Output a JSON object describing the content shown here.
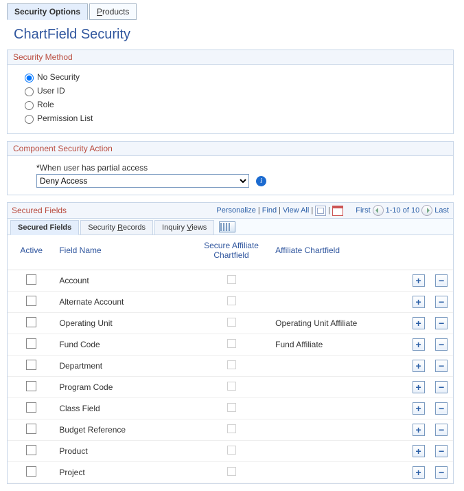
{
  "tabs": {
    "active": "Security Options",
    "other": "Products"
  },
  "page_title": "ChartField Security",
  "security_method": {
    "header": "Security Method",
    "options": [
      "No Security",
      "User ID",
      "Role",
      "Permission List"
    ],
    "selected": "No Security"
  },
  "component_action": {
    "header": "Component Security Action",
    "label": "When user has partial access",
    "select_value": "Deny Access"
  },
  "secured_fields": {
    "header": "Secured Fields",
    "links": {
      "personalize": "Personalize",
      "find": "Find",
      "viewall": "View All",
      "first": "First",
      "last": "Last"
    },
    "range": "1-10 of 10",
    "subtabs": [
      "Secured Fields",
      "Security Records",
      "Inquiry Views"
    ],
    "columns": {
      "active": "Active",
      "field_name": "Field Name",
      "secure_affiliate": "Secure Affiliate Chartfield",
      "affiliate": "Affiliate Chartfield"
    },
    "rows": [
      {
        "name": "Account",
        "aff": ""
      },
      {
        "name": "Alternate Account",
        "aff": ""
      },
      {
        "name": "Operating Unit",
        "aff": "Operating Unit Affiliate"
      },
      {
        "name": "Fund Code",
        "aff": "Fund Affiliate"
      },
      {
        "name": "Department",
        "aff": ""
      },
      {
        "name": "Program Code",
        "aff": ""
      },
      {
        "name": "Class Field",
        "aff": ""
      },
      {
        "name": "Budget Reference",
        "aff": ""
      },
      {
        "name": "Product",
        "aff": ""
      },
      {
        "name": "Project",
        "aff": ""
      }
    ]
  }
}
